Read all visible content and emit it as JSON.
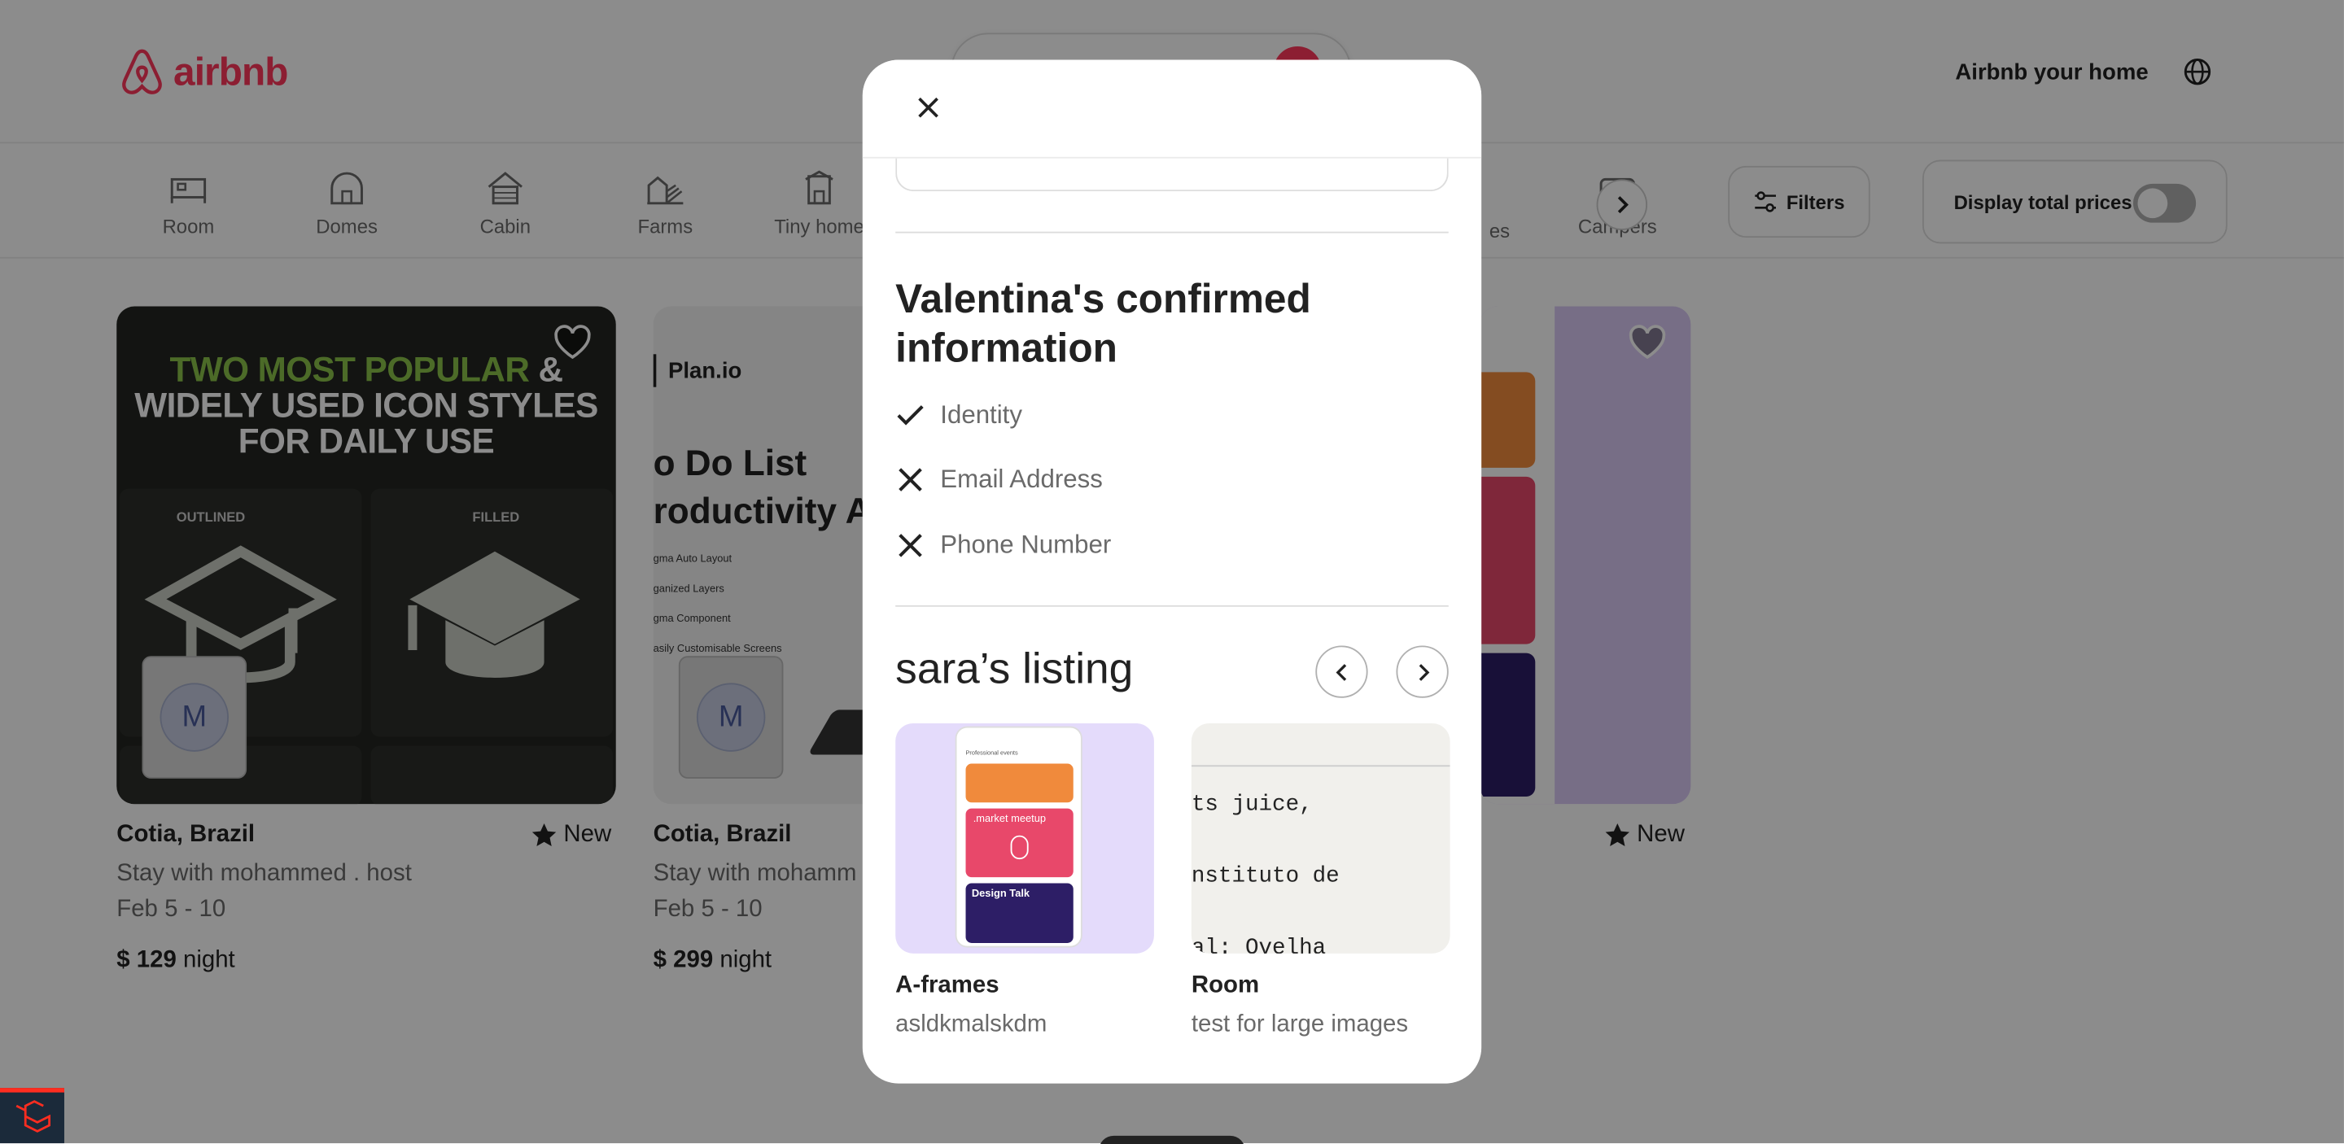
{
  "header": {
    "logo_text": "airbnb",
    "host_link": "Airbnb your home",
    "brand_color": "#ff385c"
  },
  "categories": [
    {
      "label": "Room",
      "icon": "room-icon"
    },
    {
      "label": "Domes",
      "icon": "dome-icon"
    },
    {
      "label": "Cabin",
      "icon": "cabin-icon"
    },
    {
      "label": "Farms",
      "icon": "farm-icon"
    },
    {
      "label": "Tiny home",
      "icon": "tiny-home-icon"
    },
    {
      "label": "es",
      "icon": ""
    },
    {
      "label": "Campers",
      "icon": "camper-icon"
    }
  ],
  "filters": {
    "filters_label": "Filters",
    "total_prices_label": "Display total prices"
  },
  "listings": [
    {
      "title": "Cotia, Brazil",
      "badge": "New",
      "host": "Stay with mohammed . host",
      "dates": "Feb 5 - 10",
      "price": "$ 129",
      "price_unit": "night",
      "image_heading_green": "TWO MOST POPULAR",
      "image_heading_white": "& WIDELY USED ICON STYLES FOR DAILY USE",
      "image_label_left": "OUTLINED",
      "image_label_right": "FILLED",
      "avatar_letter": "M"
    },
    {
      "title": "Cotia, Brazil",
      "host": "Stay with mohamm",
      "dates": "Feb 5 - 10",
      "price": "$ 299",
      "price_unit": "night",
      "image_brand": "Plan.io",
      "image_heading_1": "o Do List",
      "image_heading_2": "roductivity A",
      "image_lines": [
        "gma Auto Layout",
        "ganized Layers",
        "gma Component",
        "asily Customisable Screens"
      ],
      "avatar_letter": "M"
    },
    {
      "badge": "New"
    }
  ],
  "modal": {
    "section_title": "Valentina's confirmed information",
    "verifications": [
      {
        "label": "Identity",
        "status": "confirmed",
        "icon": "check-icon"
      },
      {
        "label": "Email Address",
        "status": "not-confirmed",
        "icon": "close-icon"
      },
      {
        "label": "Phone Number",
        "status": "not-confirmed",
        "icon": "close-icon"
      }
    ],
    "listings_title": "sara’s listing",
    "listing_cards": [
      {
        "name": "A-frames",
        "description": "asldkmalskdm",
        "image_phone_header": "Professional events",
        "image_card_1": ".market meetup",
        "image_card_2": "Design Talk"
      },
      {
        "name": "Room",
        "description": "test for large images",
        "image_lines": [
          "ts juice,",
          "nstituto de",
          "al: Ovelha"
        ]
      }
    ]
  }
}
